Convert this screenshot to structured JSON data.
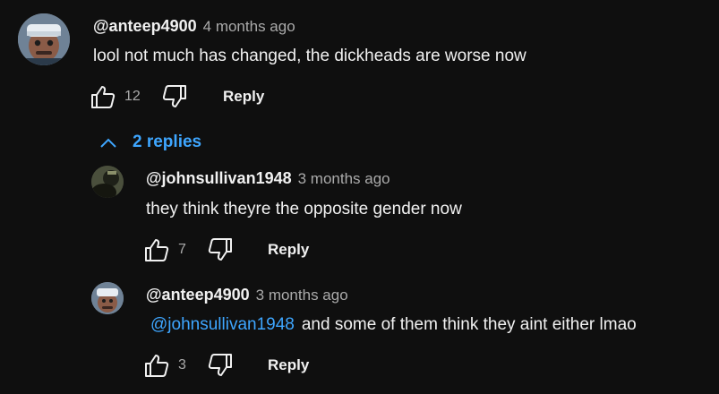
{
  "comment": {
    "author": "@anteep4900",
    "time": "4 months ago",
    "text": "lool not much has changed, the dickheads are worse now",
    "likes": "12",
    "reply_label": "Reply",
    "avatar_icon": "user-avatar"
  },
  "replies_toggle": {
    "label": "2 replies",
    "icon": "chevron-up-icon"
  },
  "replies": [
    {
      "author": "@johnsullivan1948",
      "time": "3 months ago",
      "text": "they think theyre the opposite gender now",
      "likes": "7",
      "reply_label": "Reply"
    },
    {
      "author": "@anteep4900",
      "time": "3 months ago",
      "mention": "@johnsullivan1948",
      "text": "and some of them think they aint either lmao",
      "likes": "3",
      "reply_label": "Reply"
    }
  ],
  "colors": {
    "background": "#0f0f0f",
    "text": "#f1f1f1",
    "secondary": "#aaaaaa",
    "link": "#3ea6ff"
  }
}
